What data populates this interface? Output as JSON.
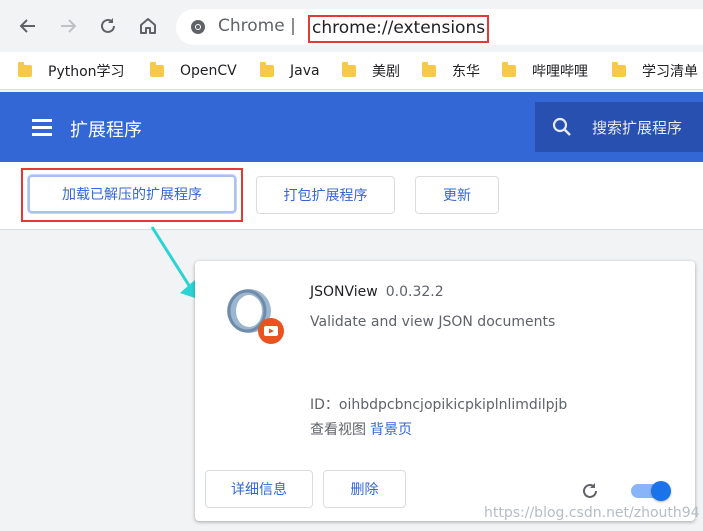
{
  "browser": {
    "site_label": "Chrome",
    "separator": "|",
    "url": "chrome://extensions"
  },
  "bookmarks": [
    {
      "label": "Python学习"
    },
    {
      "label": "OpenCV"
    },
    {
      "label": "Java"
    },
    {
      "label": "美剧"
    },
    {
      "label": "东华"
    },
    {
      "label": "哔哩哔哩"
    },
    {
      "label": "学习清单"
    }
  ],
  "extensions_page": {
    "title": "扩展程序",
    "search_placeholder": "搜索扩展程序",
    "header_color": "#3367d6"
  },
  "actions": {
    "load_unpacked": "加载已解压的扩展程序",
    "pack": "打包扩展程序",
    "update": "更新"
  },
  "extension": {
    "name": "JSONView",
    "version": "0.0.32.2",
    "description": "Validate and view JSON documents",
    "id_label": "ID：oihbdpcbncjopikicpkiplnlimdilpjb",
    "inspect_label": "查看视图",
    "inspect_link": "背景页",
    "details_button": "详细信息",
    "remove_button": "删除",
    "enabled": true
  },
  "watermark": "https://blog.csdn.net/zhouth94",
  "colors": {
    "accent": "#3367d6",
    "highlight": "#e53935",
    "arrow": "#2bd4d4"
  }
}
